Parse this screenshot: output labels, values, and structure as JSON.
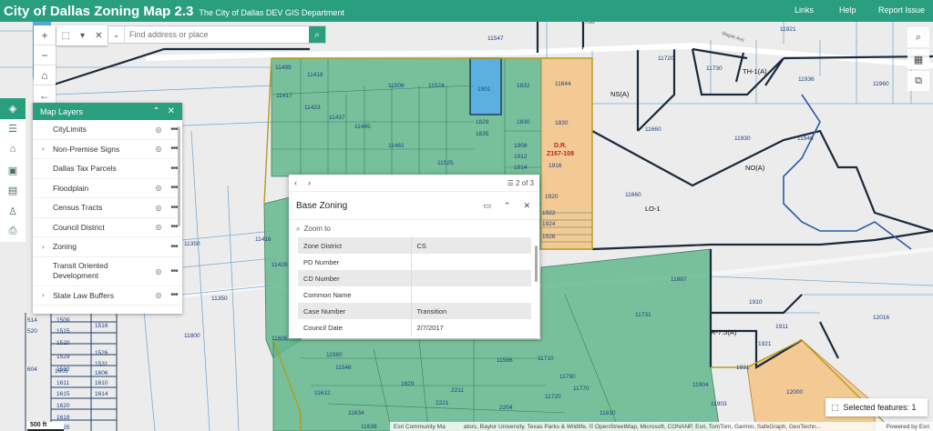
{
  "header": {
    "title": "City of Dallas Zoning Map 2.3",
    "subtitle": "The City of Dallas DEV GIS Department",
    "links": [
      "Links",
      "Help",
      "Report Issue"
    ]
  },
  "search": {
    "placeholder": "Find address or place"
  },
  "layers_panel": {
    "title": "Map Layers",
    "items": [
      {
        "label": "CityLimits",
        "expandable": false,
        "eye": true
      },
      {
        "label": "Non-Premise Signs",
        "expandable": true,
        "eye": true
      },
      {
        "label": "Dallas Tax Parcels",
        "expandable": false,
        "eye": false
      },
      {
        "label": "Floodplain",
        "expandable": false,
        "eye": true
      },
      {
        "label": "Census Tracts",
        "expandable": false,
        "eye": true
      },
      {
        "label": "Council District",
        "expandable": false,
        "eye": true
      },
      {
        "label": "Zoning",
        "expandable": true,
        "eye": false
      },
      {
        "label": "Transit Oriented Development",
        "expandable": false,
        "eye": true
      },
      {
        "label": "State Law Buffers",
        "expandable": true,
        "eye": true
      }
    ]
  },
  "popup": {
    "pager": "2 of 3",
    "title": "Base Zoning",
    "zoom_to": "Zoom to",
    "rows": [
      [
        "Zone District",
        "CS"
      ],
      [
        "PD Number",
        ""
      ],
      [
        "CD Number",
        ""
      ],
      [
        "Common Name",
        ""
      ],
      [
        "Case Number",
        "Transition"
      ],
      [
        "Council Date",
        "2/7/2017"
      ]
    ]
  },
  "selected_features": "Selected features: 1",
  "attribution": "Esri Community Ma",
  "attribution_rest": "ators, Baylor University, Texas Parks & Wildlife, © OpenStreetMap, Microsoft, CONANP, Esri, TomTom, Garmin, SafeGraph, GeoTechn...",
  "powered_by": "Powered by Esri",
  "scale": "500 ft",
  "map_labels": {
    "zoning_districts": [
      "NS(A)",
      "TH-1(A)",
      "NO(A)",
      "LO-1",
      "R-7.5(A)"
    ],
    "dr_case": [
      "D.R.",
      "Z167-108"
    ],
    "street": "Maple Ave",
    "parcels": [
      "11547",
      "1700",
      "11921",
      "11720",
      "11730",
      "11936",
      "11960",
      "11499",
      "11418",
      "11508",
      "11524",
      "1901",
      "1832",
      "11644",
      "11417",
      "11423",
      "11437",
      "11445",
      "1829",
      "1830",
      "1830",
      "11660",
      "11930",
      "11946",
      "1835",
      "11461",
      "1908",
      "1912",
      "1914",
      "1916",
      "11525",
      "11660",
      "1920",
      "1922",
      "1924",
      "1926",
      "11416",
      "11350",
      "11428",
      "11600",
      "11887",
      "1910",
      "1911",
      "1921",
      "1931",
      "11731",
      "12016",
      "11800",
      "11710",
      "11566",
      "11560",
      "11546",
      "11612",
      "11634",
      "11638",
      "1629",
      "2221",
      "2211",
      "2204",
      "11790",
      "11720",
      "11810",
      "11606",
      "11904",
      "11903",
      "12000",
      "1509",
      "1515",
      "1520",
      "1616",
      "1529",
      "1526",
      "1531",
      "1532",
      "1605",
      "1606",
      "1611",
      "1610",
      "1615",
      "1614",
      "1620",
      "1618",
      "1625",
      "514",
      "520",
      "604"
    ]
  }
}
